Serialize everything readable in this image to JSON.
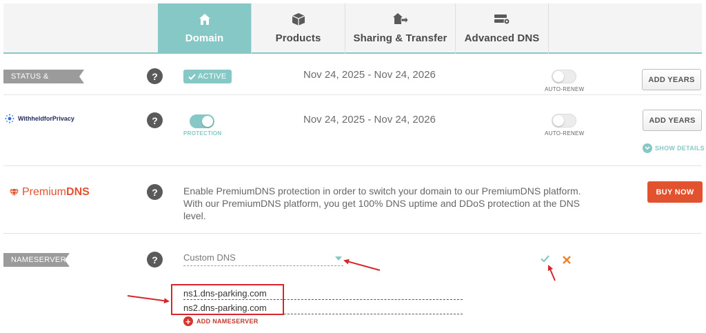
{
  "tabs": [
    {
      "label": "Domain",
      "icon": "home-icon",
      "active": true
    },
    {
      "label": "Products",
      "icon": "box-icon",
      "active": false
    },
    {
      "label": "Sharing & Transfer",
      "icon": "share-transfer-icon",
      "active": false
    },
    {
      "label": "Advanced DNS",
      "icon": "server-settings-icon",
      "active": false
    }
  ],
  "status": {
    "section_label": "STATUS & VALIDITY",
    "badge": "ACTIVE",
    "dates": "Nov 24, 2025 - Nov 24, 2026",
    "auto_renew_label": "AUTO-RENEW",
    "auto_renew_on": false,
    "add_years": "ADD YEARS"
  },
  "privacy": {
    "logo_text": "WithheldforPrivacy",
    "protection_label": "PROTECTION",
    "protection_on": true,
    "dates": "Nov 24, 2025 - Nov 24, 2026",
    "auto_renew_label": "AUTO-RENEW",
    "auto_renew_on": false,
    "add_years": "ADD YEARS",
    "show_details": "SHOW DETAILS"
  },
  "premium": {
    "logo_text_light": "Premium",
    "logo_text_bold": "DNS",
    "description": "Enable PremiumDNS protection in order to switch your domain to our PremiumDNS platform. With our PremiumDNS platform, you get 100% DNS uptime and DDoS protection at the DNS level.",
    "buy_now": "BUY NOW"
  },
  "nameservers": {
    "section_label": "NAMESERVERS",
    "selected": "Custom DNS",
    "servers": [
      "ns1.dns-parking.com",
      "ns2.dns-parking.com"
    ],
    "add_label": "ADD NAMESERVER"
  },
  "help_symbol": "?",
  "colors": {
    "accent": "#86c8c5",
    "buy": "#e2522f",
    "highlight": "#d4262c",
    "confirm": "#86c8c5",
    "cancel": "#f07f22"
  }
}
